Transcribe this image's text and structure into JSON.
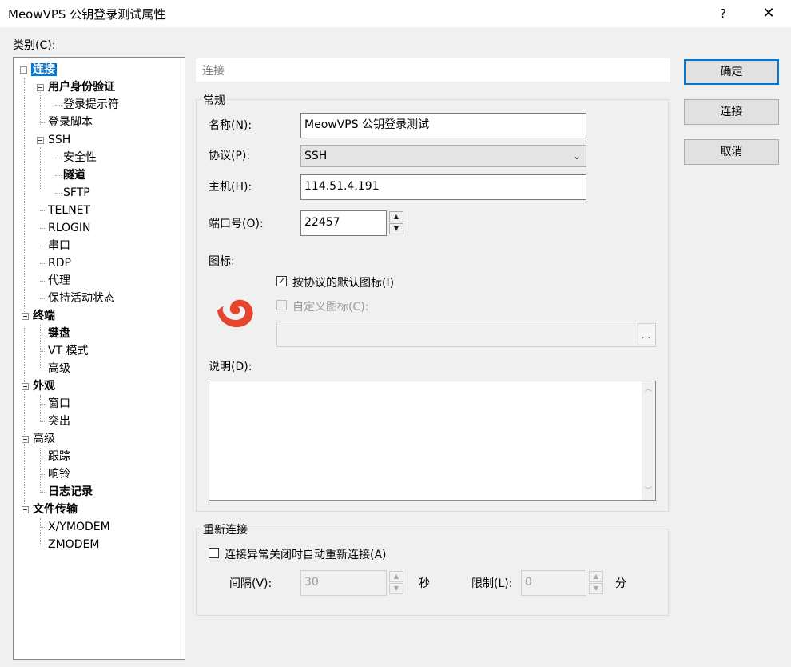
{
  "window": {
    "title": "MeowVPS 公钥登录测试属性",
    "help": "?",
    "close": "✕"
  },
  "category_label": "类别(C):",
  "tree": [
    {
      "label": "连接",
      "bold": true,
      "selected": true
    },
    {
      "label": "用户身份验证",
      "bold": true
    },
    {
      "label": "登录提示符"
    },
    {
      "label": "登录脚本"
    },
    {
      "label": "SSH"
    },
    {
      "label": "安全性"
    },
    {
      "label": "隧道",
      "bold": true
    },
    {
      "label": "SFTP"
    },
    {
      "label": "TELNET"
    },
    {
      "label": "RLOGIN"
    },
    {
      "label": "串口"
    },
    {
      "label": "RDP"
    },
    {
      "label": "代理"
    },
    {
      "label": "保持活动状态"
    },
    {
      "label": "终端",
      "bold": true
    },
    {
      "label": "键盘",
      "bold": true
    },
    {
      "label": "VT 模式"
    },
    {
      "label": "高级"
    },
    {
      "label": "外观",
      "bold": true
    },
    {
      "label": "窗口"
    },
    {
      "label": "突出"
    },
    {
      "label": "高级"
    },
    {
      "label": "跟踪"
    },
    {
      "label": "响铃"
    },
    {
      "label": "日志记录",
      "bold": true
    },
    {
      "label": "文件传输",
      "bold": true
    },
    {
      "label": "X/YMODEM"
    },
    {
      "label": "ZMODEM"
    }
  ],
  "panel_header": "连接",
  "general": {
    "title": "常规",
    "name_label": "名称(N):",
    "name_value": "MeowVPS 公钥登录测试",
    "protocol_label": "协议(P):",
    "protocol_value": "SSH",
    "host_label": "主机(H):",
    "host_value": "114.51.4.191",
    "port_label": "端口号(O):",
    "port_value": "22457",
    "icon_label": "图标:",
    "default_icon_label": "按协议的默认图标(I)",
    "default_icon_checked": true,
    "custom_icon_label": "自定义图标(C):",
    "custom_icon_checked": false,
    "browse": "...",
    "desc_label": "说明(D):"
  },
  "reconnect": {
    "title": "重新连接",
    "auto_label": "连接异常关闭时自动重新连接(A)",
    "auto_checked": false,
    "interval_label": "间隔(V):",
    "interval_value": "30",
    "seconds_unit": "秒",
    "limit_label": "限制(L):",
    "limit_value": "0",
    "minutes_unit": "分"
  },
  "buttons": {
    "ok": "确定",
    "connect": "连接",
    "cancel": "取消"
  },
  "colors": {
    "selection": "#0078d7",
    "icon_red": "#e5452c"
  }
}
